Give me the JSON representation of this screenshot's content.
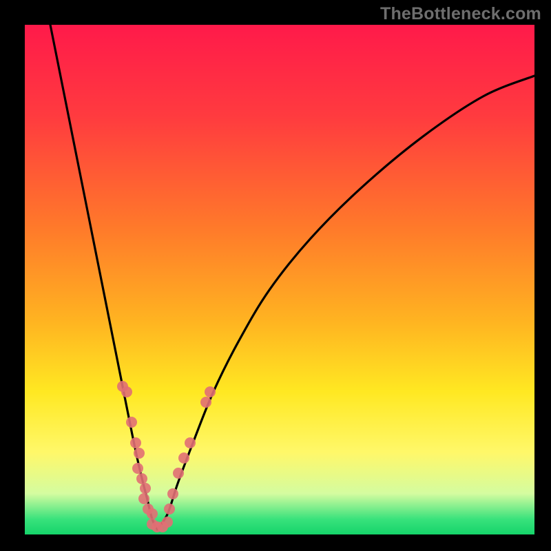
{
  "watermark": "TheBottleneck.com",
  "colors": {
    "frame": "#000000",
    "gradient_stops": [
      {
        "pos": 0.0,
        "color": "#ff1a4a"
      },
      {
        "pos": 0.18,
        "color": "#ff3b3f"
      },
      {
        "pos": 0.4,
        "color": "#ff7a2a"
      },
      {
        "pos": 0.58,
        "color": "#ffb321"
      },
      {
        "pos": 0.72,
        "color": "#ffe822"
      },
      {
        "pos": 0.84,
        "color": "#fff86a"
      },
      {
        "pos": 0.92,
        "color": "#d4fca0"
      },
      {
        "pos": 0.97,
        "color": "#39e27c"
      },
      {
        "pos": 1.0,
        "color": "#15d46a"
      }
    ],
    "curve": "#000000",
    "marker": "#e16f74"
  },
  "chart_data": {
    "type": "line",
    "title": "",
    "xlabel": "",
    "ylabel": "",
    "xrange": [
      0,
      100
    ],
    "yrange": [
      0,
      100
    ],
    "axes_visible": false,
    "grid": false,
    "series": [
      {
        "name": "left-branch",
        "x": [
          5,
          7,
          9,
          11,
          13,
          15,
          17,
          19,
          21,
          22.5,
          24,
          25,
          26
        ],
        "y": [
          100,
          90,
          80,
          70,
          60,
          50,
          40,
          30,
          20,
          13,
          7,
          3,
          1
        ]
      },
      {
        "name": "right-branch",
        "x": [
          26,
          28,
          30,
          33,
          37,
          42,
          48,
          56,
          66,
          78,
          90,
          100
        ],
        "y": [
          1,
          4,
          10,
          18,
          28,
          38,
          48,
          58,
          68,
          78,
          86,
          90
        ]
      }
    ],
    "markers": {
      "name": "scatter-points",
      "points": [
        {
          "x": 20.0,
          "y": 28
        },
        {
          "x": 19.2,
          "y": 29
        },
        {
          "x": 21.0,
          "y": 22
        },
        {
          "x": 21.8,
          "y": 18
        },
        {
          "x": 22.4,
          "y": 16
        },
        {
          "x": 22.2,
          "y": 13
        },
        {
          "x": 23.0,
          "y": 11
        },
        {
          "x": 23.6,
          "y": 9
        },
        {
          "x": 23.4,
          "y": 7
        },
        {
          "x": 24.2,
          "y": 5
        },
        {
          "x": 25.0,
          "y": 4
        },
        {
          "x": 25.0,
          "y": 2
        },
        {
          "x": 26.0,
          "y": 1.5
        },
        {
          "x": 27.0,
          "y": 1.5
        },
        {
          "x": 28.0,
          "y": 2.5
        },
        {
          "x": 28.4,
          "y": 5
        },
        {
          "x": 29.0,
          "y": 8
        },
        {
          "x": 30.2,
          "y": 12
        },
        {
          "x": 31.2,
          "y": 15
        },
        {
          "x": 32.4,
          "y": 18
        },
        {
          "x": 35.6,
          "y": 26
        },
        {
          "x": 36.4,
          "y": 28
        }
      ]
    }
  }
}
